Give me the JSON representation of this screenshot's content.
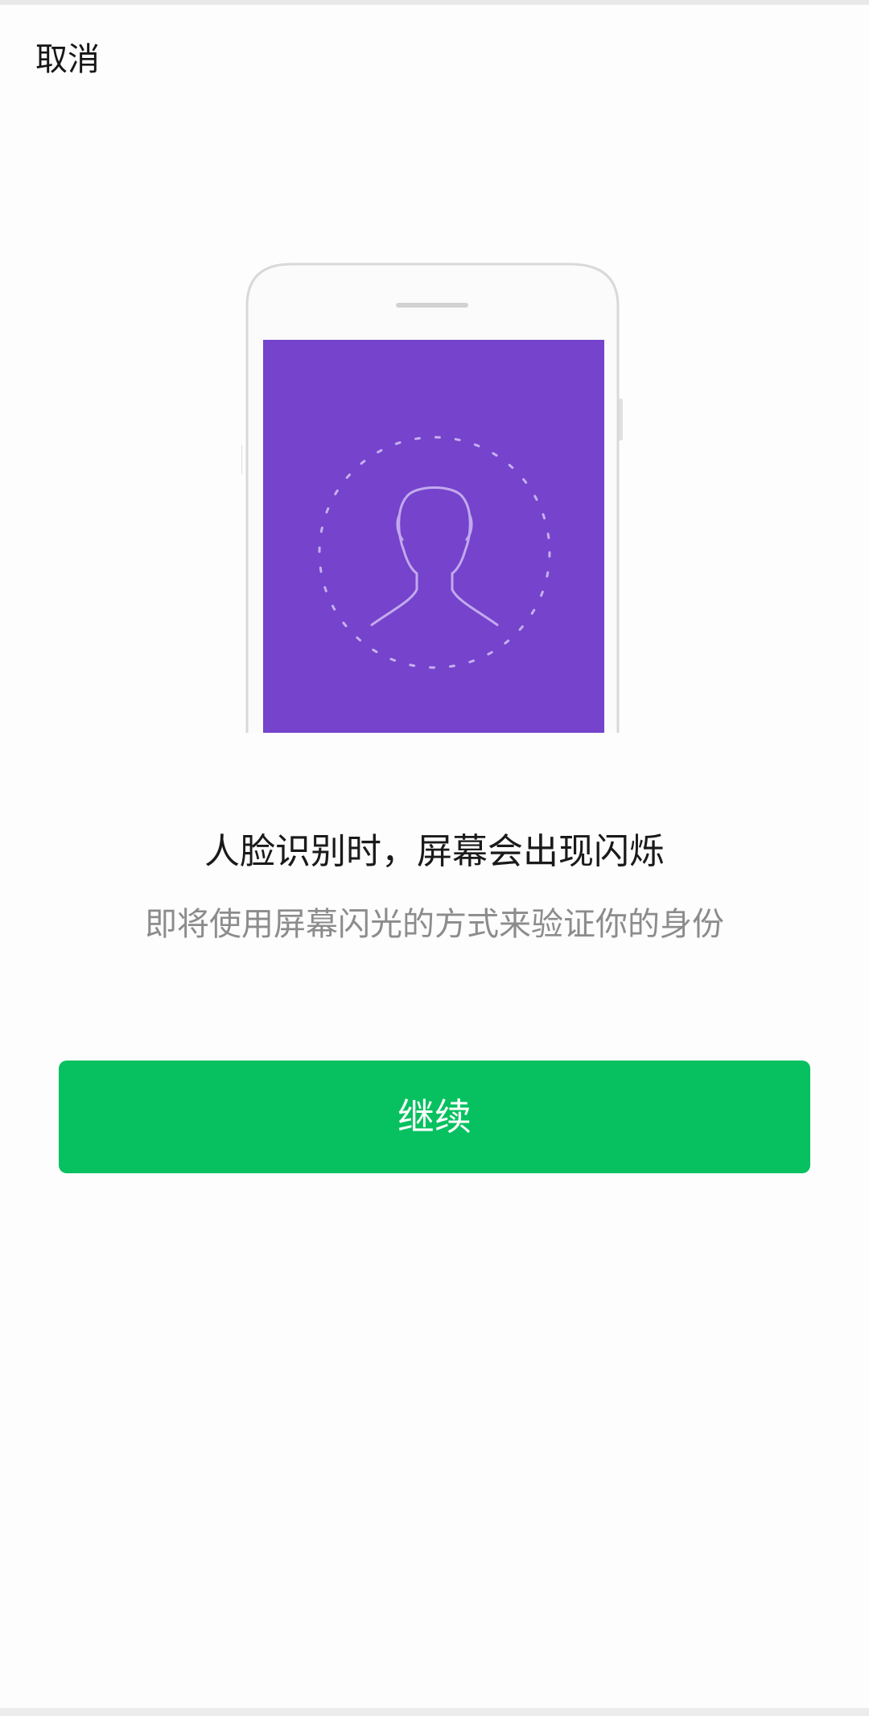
{
  "header": {
    "cancel_label": "取消"
  },
  "illustration": {
    "icon": "face-scan-illustration",
    "screen_color": "#7543cc"
  },
  "content": {
    "headline": "人脸识别时，屏幕会出现闪烁",
    "subline": "即将使用屏幕闪光的方式来验证你的身份"
  },
  "actions": {
    "continue_label": "继续"
  },
  "colors": {
    "primary_button": "#07c160",
    "text_primary": "#1a1a1a",
    "text_secondary": "#8c8c8c",
    "background": "#fdfdfd"
  }
}
